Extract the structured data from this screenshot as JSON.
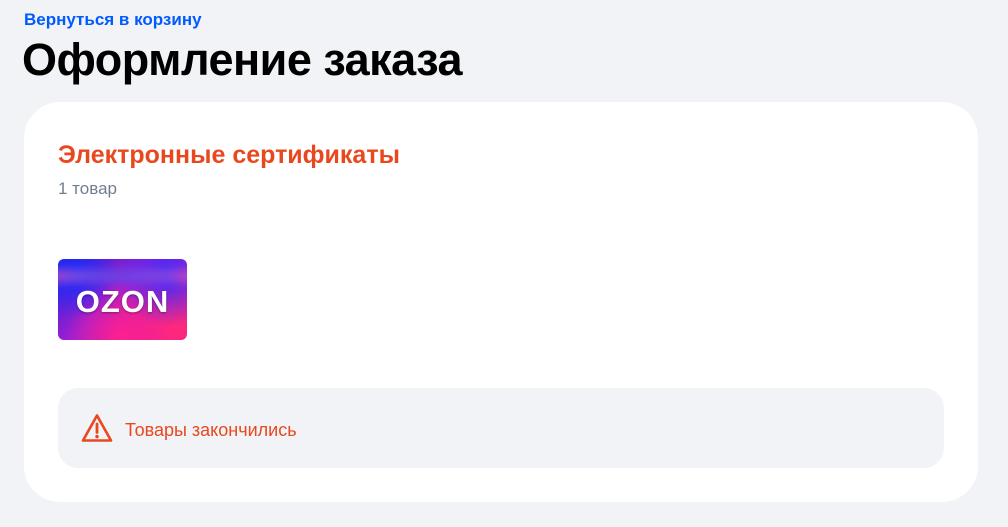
{
  "header": {
    "back_link_label": "Вернуться в корзину",
    "page_title": "Оформление заказа"
  },
  "section": {
    "title": "Электронные сертификаты",
    "item_count": "1 товар",
    "products": [
      {
        "logo_text": "OZON"
      }
    ],
    "alert": {
      "icon": "warning-triangle-icon",
      "text": "Товары закончились"
    }
  },
  "colors": {
    "accent_link": "#005bff",
    "accent_warning": "#e9481f",
    "page_background": "#f1f3f6",
    "card_background": "#ffffff"
  }
}
